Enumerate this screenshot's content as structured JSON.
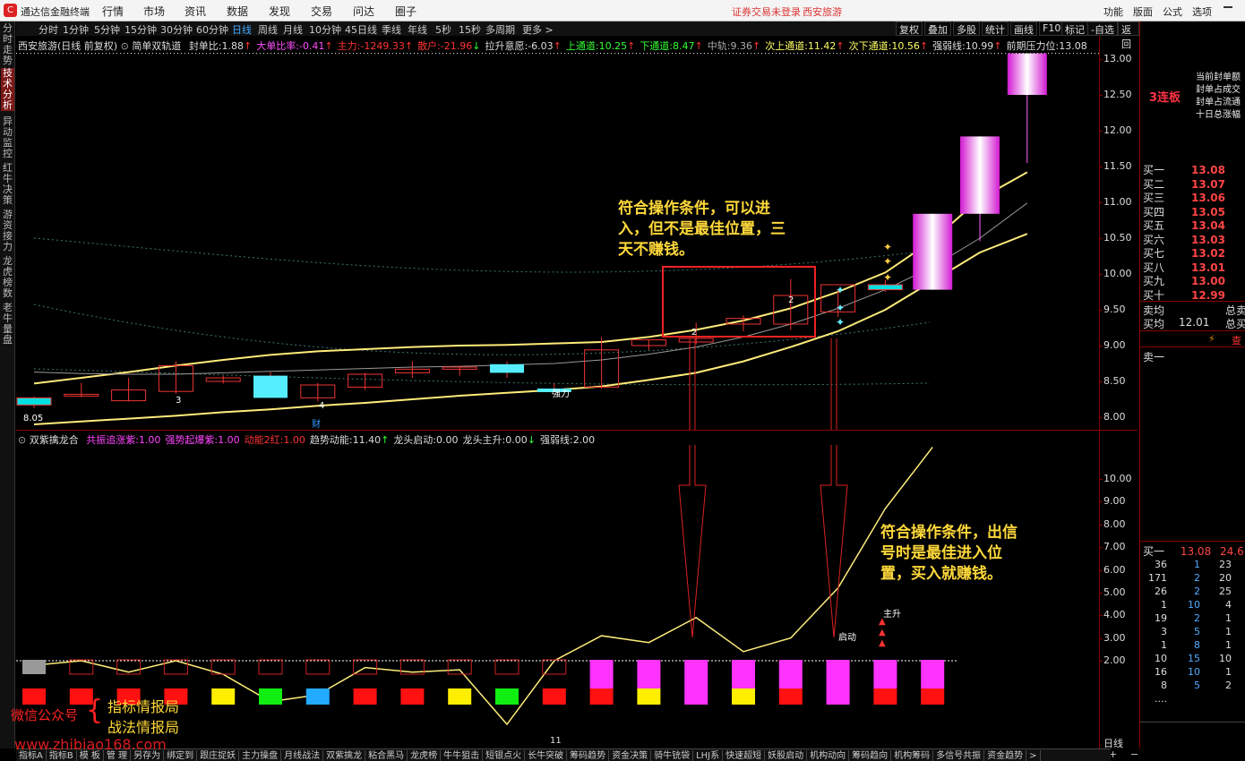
{
  "app": {
    "title": "通达信金融终端",
    "menu": [
      "行情",
      "市场",
      "资讯",
      "数据",
      "发现",
      "交易",
      "问达",
      "圈子"
    ],
    "login": "证券交易未登录",
    "stock_name": "西安旅游",
    "top_right": [
      "功能",
      "版面",
      "公式",
      "选项"
    ]
  },
  "periods": [
    "分时",
    "1分钟",
    "5分钟",
    "15分钟",
    "30分钟",
    "60分钟",
    "日线",
    "周线",
    "月线",
    "10分钟",
    "45日线",
    "季线",
    "年线",
    "5秒",
    "15秒",
    "多周期",
    "更多 >"
  ],
  "toolbar_right": [
    "复权",
    "叠加",
    "多股",
    "统计",
    "画线",
    "F10",
    "标记",
    "-自选",
    "返回"
  ],
  "sidebar": [
    "分时走势",
    "技术分析",
    "异动监控",
    "红牛决策",
    "游资接力",
    "龙虎榜数",
    "老牛量盘"
  ],
  "main_info": {
    "stock": "西安旅游(日线 前复权)",
    "indicator": "简单双轨道",
    "fields": [
      {
        "label": "封单比:",
        "value": "1.88",
        "arrow": "↑",
        "color": "#ddd"
      },
      {
        "label": "大单比率:",
        "value": "-0.41",
        "arrow": "↑",
        "color": "#ff4fff"
      },
      {
        "label": "主力:",
        "value": "-1249.33",
        "arrow": "↑",
        "color": "#ff3333"
      },
      {
        "label": "散户:",
        "value": "-21.96",
        "arrow": "↓",
        "color": "#ff3333"
      },
      {
        "label": "拉升意愿:",
        "value": "-6.03",
        "arrow": "↑",
        "color": "#ddd"
      },
      {
        "label": "上通道:",
        "value": "10.25",
        "arrow": "↑",
        "color": "#33ff33"
      },
      {
        "label": "下通道:",
        "value": "8.47",
        "arrow": "↑",
        "color": "#33ff33"
      },
      {
        "label": "中轨:",
        "value": "9.36",
        "arrow": "↑",
        "color": "#aaa"
      },
      {
        "label": "次上通道:",
        "value": "11.42",
        "arrow": "↑",
        "color": "#ffff66"
      },
      {
        "label": "次下通道:",
        "value": "10.56",
        "arrow": "↑",
        "color": "#ffff66"
      },
      {
        "label": "强弱线:",
        "value": "10.99",
        "arrow": "↑",
        "color": "#ddd"
      },
      {
        "label": "前期压力位:",
        "value": "13.08",
        "arrow": "",
        "color": "#ddd"
      }
    ]
  },
  "sub_info": {
    "indicator": "双紫擒龙合",
    "fields": [
      {
        "label": "共振追涨紫:",
        "value": "1.00",
        "color": "#ff44ff"
      },
      {
        "label": "强势起爆紫:",
        "value": "1.00",
        "color": "#ff44ff"
      },
      {
        "label": "动能2红:",
        "value": "1.00",
        "color": "#ff3333"
      },
      {
        "label": "趋势动能:",
        "value": "11.40",
        "arrow": "↑",
        "color": "#ddd"
      },
      {
        "label": "龙头启动:",
        "value": "0.00",
        "color": "#ddd"
      },
      {
        "label": "龙头主升:",
        "value": "0.00",
        "arrow": "↓",
        "color": "#ddd"
      },
      {
        "label": "强弱线:",
        "value": "2.00",
        "color": "#ddd"
      }
    ]
  },
  "chart_data": [
    {
      "type": "candlestick",
      "y_ticks": [
        "13.00",
        "12.50",
        "12.00",
        "11.50",
        "11.00",
        "10.50",
        "10.00",
        "9.50",
        "9.00",
        "8.50",
        "8.00"
      ],
      "labels": [
        "8.05",
        "3",
        "4",
        "2",
        "2",
        "强力",
        "财",
        "3连板",
        "前期压力位"
      ],
      "candles": [
        {
          "o": 8.27,
          "h": 8.29,
          "l": 8.13,
          "c": 8.17
        },
        {
          "o": 8.3,
          "h": 8.48,
          "l": 8.28,
          "c": 8.32
        },
        {
          "o": 8.23,
          "h": 8.55,
          "l": 8.22,
          "c": 8.38
        },
        {
          "o": 8.36,
          "h": 8.78,
          "l": 8.33,
          "c": 8.72
        },
        {
          "o": 8.5,
          "h": 8.58,
          "l": 8.47,
          "c": 8.55
        },
        {
          "o": 8.58,
          "h": 8.63,
          "l": 8.27,
          "c": 8.27
        },
        {
          "o": 8.27,
          "h": 8.48,
          "l": 8.22,
          "c": 8.45
        },
        {
          "o": 8.42,
          "h": 8.62,
          "l": 8.38,
          "c": 8.6
        },
        {
          "o": 8.62,
          "h": 8.78,
          "l": 8.55,
          "c": 8.67
        },
        {
          "o": 8.67,
          "h": 8.72,
          "l": 8.58,
          "c": 8.7
        },
        {
          "o": 8.74,
          "h": 8.78,
          "l": 8.55,
          "c": 8.62
        },
        {
          "o": 8.4,
          "h": 8.47,
          "l": 8.35,
          "c": 8.35
        },
        {
          "o": 8.42,
          "h": 9.12,
          "l": 8.4,
          "c": 8.94
        },
        {
          "o": 9.0,
          "h": 9.08,
          "l": 8.94,
          "c": 9.08
        },
        {
          "o": 9.05,
          "h": 9.32,
          "l": 9.02,
          "c": 9.1
        },
        {
          "o": 9.3,
          "h": 9.42,
          "l": 9.2,
          "c": 9.38
        },
        {
          "o": 9.3,
          "h": 9.93,
          "l": 9.22,
          "c": 9.7
        },
        {
          "o": 9.47,
          "h": 9.78,
          "l": 9.4,
          "c": 9.85
        },
        {
          "o": 9.85,
          "h": 9.92,
          "l": 9.75,
          "c": 9.78
        },
        {
          "o": 9.78,
          "h": 10.84,
          "l": 9.78,
          "c": 10.84
        },
        {
          "o": 10.84,
          "h": 11.92,
          "l": 10.46,
          "c": 11.92
        },
        {
          "o": 12.5,
          "h": 13.08,
          "l": 11.55,
          "c": 13.08
        }
      ],
      "series": [
        {
          "name": "上通道",
          "values": [
            8.47,
            8.55,
            8.63,
            8.72,
            8.8,
            8.87,
            8.92,
            8.95,
            8.98,
            9.0,
            9.01,
            9.03,
            9.05,
            9.12,
            9.22,
            9.35,
            9.52,
            9.75,
            10.02,
            10.47,
            11.05,
            11.42
          ]
        },
        {
          "name": "下通道",
          "values": [
            7.9,
            7.94,
            7.98,
            8.02,
            8.07,
            8.11,
            8.16,
            8.2,
            8.25,
            8.3,
            8.34,
            8.38,
            8.43,
            8.52,
            8.62,
            8.78,
            8.98,
            9.2,
            9.5,
            9.9,
            10.3,
            10.56
          ]
        },
        {
          "name": "中轨",
          "values": [
            8.63,
            8.61,
            8.6,
            8.6,
            8.62,
            8.64,
            8.66,
            8.68,
            8.7,
            8.71,
            8.73,
            8.75,
            8.8,
            8.88,
            8.98,
            9.12,
            9.3,
            9.52,
            9.78,
            10.1,
            10.5,
            10.99
          ]
        }
      ]
    },
    {
      "type": "line",
      "y_ticks": [
        "10.00",
        "9.00",
        "8.00",
        "7.00",
        "6.00",
        "5.00",
        "4.00",
        "3.00",
        "2.00"
      ],
      "labels": [
        "启动",
        "主升"
      ],
      "series": [
        {
          "name": "趋势动能",
          "values": [
            1.8,
            2.0,
            1.5,
            2.0,
            1.4,
            0.2,
            0.5,
            1.7,
            1.5,
            1.6,
            -0.8,
            2.0,
            3.1,
            2.8,
            3.9,
            2.4,
            3.0,
            5.2,
            8.7,
            11.4
          ]
        }
      ]
    }
  ],
  "annotations": {
    "top": [
      "符合操作条件，可以进",
      "入，但不是最佳位置，三",
      "天不赚钱。"
    ],
    "bottom": [
      "符合操作条件，出信",
      "号时是最佳进入位",
      "置，买入就赚钱。"
    ]
  },
  "board": "3连板",
  "board_notes": [
    "当前封单额",
    "封单占成交",
    "封单占流通",
    "十日总涨幅"
  ],
  "order_book": [
    {
      "label": "买一",
      "price": "13.08"
    },
    {
      "label": "买二",
      "price": "13.07"
    },
    {
      "label": "买三",
      "price": "13.06"
    },
    {
      "label": "买四",
      "price": "13.05"
    },
    {
      "label": "买五",
      "price": "13.04"
    },
    {
      "label": "买六",
      "price": "13.03"
    },
    {
      "label": "买七",
      "price": "13.02"
    },
    {
      "label": "买八",
      "price": "13.01"
    },
    {
      "label": "买九",
      "price": "13.00"
    },
    {
      "label": "买十",
      "price": "12.99"
    }
  ],
  "avg": [
    {
      "label": "卖均",
      "price": "",
      "tail": "总卖"
    },
    {
      "label": "买均",
      "price": "12.01",
      "tail": "总买"
    }
  ],
  "sell_one": "卖一",
  "query": "查",
  "bid_row": {
    "label": "买一",
    "price": "13.08",
    "vol": "24.6"
  },
  "queue": [
    [
      "36",
      "1",
      "23"
    ],
    [
      "171",
      "2",
      "20"
    ],
    [
      "26",
      "2",
      "25"
    ],
    [
      "1",
      "10",
      "4"
    ],
    [
      "19",
      "2",
      "1"
    ],
    [
      "3",
      "5",
      "1"
    ],
    [
      "1",
      "8",
      "1"
    ],
    [
      "10",
      "15",
      "10"
    ],
    [
      "16",
      "10",
      "1"
    ],
    [
      "8",
      "5",
      "2"
    ],
    [
      "....",
      "",
      ""
    ]
  ],
  "tabs": [
    "指标A",
    "指标B",
    "模 板",
    "管 理",
    "另存为",
    "绑定到",
    "跟庄捉妖",
    "主力操盘",
    "月线战法",
    "双紫擒龙",
    "粘合黑马",
    "龙虎榜",
    "牛牛狙击",
    "短银点火",
    "长牛突破",
    "筹码趋势",
    "资金决策",
    "骑牛铳袋",
    "LHJ系",
    "快速超短",
    "妖股启动",
    "机构动向",
    "筹码趋向",
    "机构筹码",
    "多信号共振",
    "资金趋势",
    ">"
  ],
  "period_label": "日线",
  "x_label": "11",
  "watermark": {
    "prefix": "微信公众号",
    "line1": "指标情报局",
    "line2": "战法情报局",
    "url": "www.zhibiao168.com"
  }
}
